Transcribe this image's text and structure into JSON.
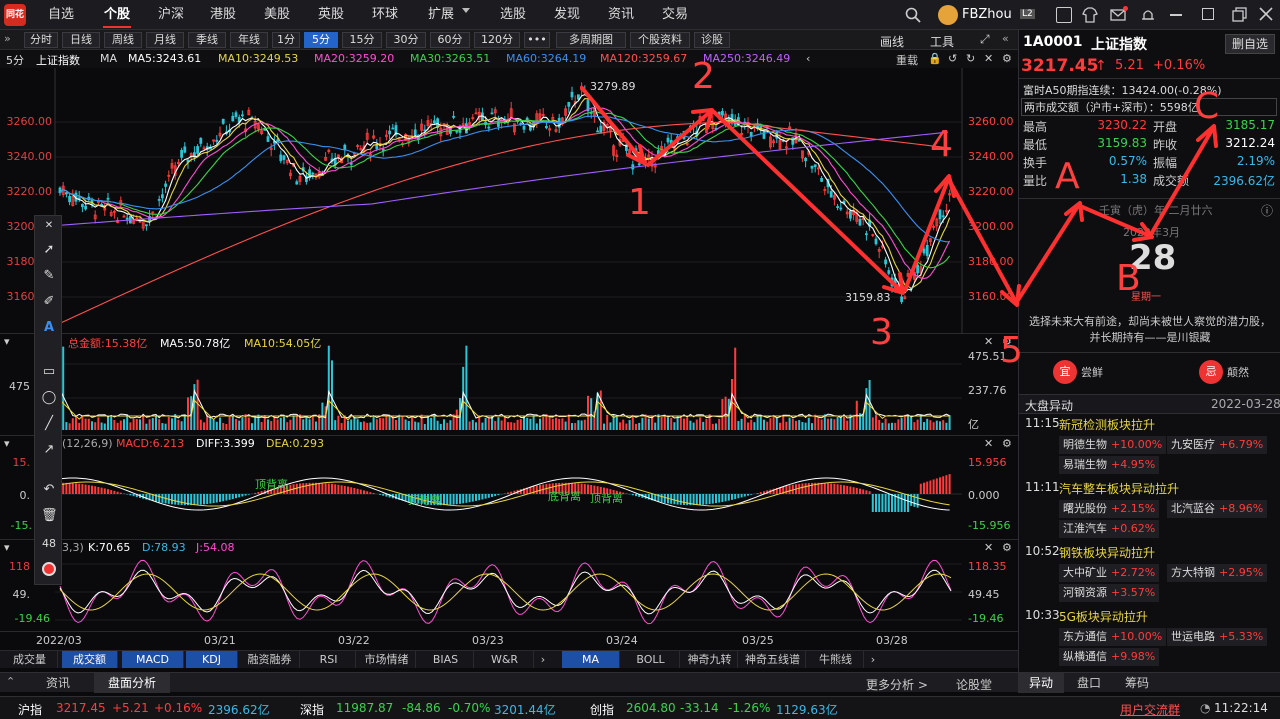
{
  "nav": {
    "logo": "同花顺",
    "items": [
      "自选",
      "个股",
      "沪深",
      "港股",
      "美股",
      "英股",
      "环球",
      "扩展",
      "选股",
      "发现",
      "资讯",
      "交易"
    ],
    "active": "个股",
    "user": "FBZhou",
    "level": "L2"
  },
  "toolbar": {
    "periods": [
      "分时",
      "日线",
      "周线",
      "月线",
      "季线",
      "年线",
      "1分",
      "5分",
      "15分",
      "30分",
      "60分",
      "120分"
    ],
    "selected": "5分",
    "more": "•••",
    "extra": [
      "多周期图",
      "个股资料",
      "诊股"
    ],
    "right": [
      "画线",
      "工具"
    ]
  },
  "mabar": {
    "period": "5分",
    "name": "上证指数",
    "ma": "MA",
    "items": [
      {
        "label": "MA5:3243.61",
        "color": "#ffffff"
      },
      {
        "label": "MA10:3249.53",
        "color": "#e8d442"
      },
      {
        "label": "MA20:3259.20",
        "color": "#ff4dd2"
      },
      {
        "label": "MA30:3263.51",
        "color": "#3bd34a"
      },
      {
        "label": "MA60:3264.19",
        "color": "#3a8ff0"
      },
      {
        "label": "MA120:3259.67",
        "color": "#ff5050"
      },
      {
        "label": "MA250:3246.49",
        "color": "#c060ff"
      }
    ],
    "fuquan": "重载"
  },
  "main_axis": {
    "left": [
      "3260.00",
      "3240.00",
      "3220.00",
      "3200.00",
      "3180.00",
      "3160.00"
    ],
    "right": [
      "3260.00",
      "3240.00",
      "3220.00",
      "3200.00",
      "3180.00",
      "3160.00"
    ],
    "high_label": "3279.89",
    "low_label": "3159.83"
  },
  "volume": {
    "header": [
      {
        "label": "总金额:15.38亿",
        "color": "#ff4040"
      },
      {
        "label": "MA5:50.78亿",
        "color": "#ffffff"
      },
      {
        "label": "MA10:54.05亿",
        "color": "#e8d442"
      }
    ],
    "axis": [
      "475.51",
      "237.76",
      "亿"
    ],
    "left_axis": [
      "475",
      "237"
    ]
  },
  "macd": {
    "header": [
      {
        "label": "(12,26,9)",
        "color": "#aaaaaa"
      },
      {
        "label": "MACD:6.213",
        "color": "#ff4040"
      },
      {
        "label": "DIFF:3.399",
        "color": "#ffffff"
      },
      {
        "label": "DEA:0.293",
        "color": "#e8d442"
      }
    ],
    "axis": [
      "15.956",
      "0.000",
      "-15.956"
    ],
    "left_axis": [
      "15.",
      "0.",
      "-15."
    ],
    "tags": [
      "顶背离",
      "顶背离",
      "底背离",
      "顶背离"
    ]
  },
  "kdj": {
    "header": [
      {
        "label": "3,3)",
        "color": "#aaaaaa"
      },
      {
        "label": "K:70.65",
        "color": "#ffffff"
      },
      {
        "label": "D:78.93",
        "color": "#3ab9e8"
      },
      {
        "label": "J:54.08",
        "color": "#ff4dd2"
      }
    ],
    "axis": [
      "118.35",
      "49.45",
      "-19.46"
    ],
    "left_axis": [
      "118",
      "49.",
      "-19.46"
    ]
  },
  "dates": [
    "2022/03",
    "03/21",
    "03/22",
    "03/23",
    "03/24",
    "03/25",
    "03/28"
  ],
  "indicator_tabs_left": [
    "成交量",
    "成交额",
    "MACD",
    "KDJ",
    "融资融券",
    "RSI",
    "市场情绪",
    "BIAS",
    "W&R"
  ],
  "indicator_tabs_left_selected": [
    "成交额",
    "MACD",
    "KDJ"
  ],
  "indicator_tabs_right": [
    "MA",
    "BOLL",
    "神奇九转",
    "神奇五线谱",
    "牛熊线"
  ],
  "indicator_tabs_right_selected": "MA",
  "bottom_tabs": [
    "资讯",
    "盘面分析"
  ],
  "bottom_tabs_selected": "盘面分析",
  "bottom_right": [
    "更多分析 >",
    "论股堂",
    "异动",
    "盘口",
    "筹码"
  ],
  "status": {
    "sh_label": "沪指",
    "sh_val": "3217.45",
    "sh_chg": "+5.21",
    "sh_pct": "+0.16%",
    "sh_amt": "2396.62亿",
    "sz_label": "深指",
    "sz_val": "11987.87",
    "sz_chg": "-84.86",
    "sz_pct": "-0.70%",
    "sz_amt": "3201.44亿",
    "cy_label": "创指",
    "cy_val": "2604.80",
    "cy_chg": "-33.14",
    "cy_pct": "-1.26%",
    "cy_amt": "1129.63亿",
    "forum": "用户交流群",
    "time": "11:22:14"
  },
  "right": {
    "code": "1A0001",
    "name": "上证指数",
    "del_btn": "删自选",
    "price": "3217.45",
    "chg": "5.21",
    "pct": "+0.16%",
    "a50": "富时A50期指连续：13424.00(-0.28%)",
    "turnover": "两市成交额（沪市+深市）：5598亿",
    "stats": [
      {
        "l": "最高",
        "v": "3230.22",
        "vc": "red",
        "l2": "开盘",
        "v2": "3185.17",
        "v2c": "green"
      },
      {
        "l": "最低",
        "v": "3159.83",
        "vc": "green",
        "l2": "昨收",
        "v2": "3212.24",
        "v2c": "white"
      },
      {
        "l": "换手",
        "v": "0.57%",
        "vc": "cyan",
        "l2": "振幅",
        "v2": "2.19%",
        "v2c": "cyan"
      },
      {
        "l": "量比",
        "v": "1.38",
        "vc": "cyan",
        "l2": "成交额",
        "v2": "2396.62亿",
        "v2c": "cyan"
      }
    ],
    "lunar": "壬寅（虎）年 二月廿六",
    "month": "2022年3月",
    "day": "28",
    "weekday": "星期一",
    "quote": "选择未来大有前途，却尚未被世人察觉的潜力股，并长期持有——是川银藏",
    "yi_label": "宜",
    "yi_text": "尝鲜",
    "ji_label": "忌",
    "ji_text": "颠然",
    "section": "大盘异动",
    "section_date": "2022-03-28",
    "news": [
      {
        "time": "11:15",
        "title": "新冠检测板块拉升",
        "stocks": [
          {
            "n": "明德生物",
            "p": "+10.00%"
          },
          {
            "n": "九安医疗",
            "p": "+6.79%"
          },
          {
            "n": "易瑞生物",
            "p": "+4.95%"
          }
        ]
      },
      {
        "time": "11:11",
        "title": "汽车整车板块异动拉升",
        "stocks": [
          {
            "n": "曙光股份",
            "p": "+2.15%"
          },
          {
            "n": "北汽蓝谷",
            "p": "+8.96%"
          },
          {
            "n": "江淮汽车",
            "p": "+0.62%"
          }
        ]
      },
      {
        "time": "10:52",
        "title": "钢铁板块异动拉升",
        "stocks": [
          {
            "n": "大中矿业",
            "p": "+2.72%"
          },
          {
            "n": "方大特钢",
            "p": "+2.95%"
          },
          {
            "n": "河钢资源",
            "p": "+3.57%"
          }
        ]
      },
      {
        "time": "10:33",
        "title": "5G板块异动拉升",
        "stocks": [
          {
            "n": "东方通信",
            "p": "+10.00%"
          },
          {
            "n": "世运电路",
            "p": "+5.33%"
          },
          {
            "n": "纵横通信",
            "p": "+9.98%"
          }
        ]
      }
    ]
  },
  "annotations": [
    "1",
    "2",
    "3",
    "4",
    "5",
    "A",
    "B",
    "C"
  ],
  "drawtools": {
    "size": "48"
  }
}
